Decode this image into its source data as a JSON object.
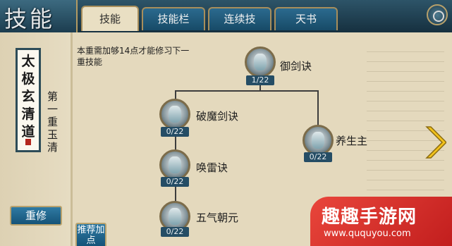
{
  "header": {
    "title": "技能",
    "tabs": [
      {
        "label": "技能",
        "active": true
      },
      {
        "label": "技能栏",
        "active": false
      },
      {
        "label": "连续技",
        "active": false
      },
      {
        "label": "天书",
        "active": false
      }
    ],
    "close_icon": "close-icon"
  },
  "left_panel": {
    "scroll_text": "太极玄清道",
    "stage_label": "第一重玉清",
    "reset_button": "重修"
  },
  "main": {
    "notice": "本重需加够14点才能修习下一重技能",
    "recommend_button": "推荐加点",
    "skills": [
      {
        "name": "御剑诀",
        "level": "1/22",
        "icon": "sword-skill-icon"
      },
      {
        "name": "破魔剑诀",
        "level": "0/22",
        "icon": "sword-break-skill-icon"
      },
      {
        "name": "养生主",
        "level": "0/22",
        "icon": "nourish-skill-icon"
      },
      {
        "name": "唤雷诀",
        "level": "0/22",
        "icon": "thunder-skill-icon"
      },
      {
        "name": "五气朝元",
        "level": "0/22",
        "icon": "five-qi-skill-icon"
      }
    ],
    "next_arrow_icon": "chevron-right-icon"
  },
  "watermark": {
    "title": "趣趣手游网",
    "url": "www.ququyou.com"
  },
  "colors": {
    "tab_active": "#e9dfc3",
    "tab_inactive": "#2b6a8e",
    "panel_bg": "#e4d9bd",
    "level_badge": "#254d65",
    "watermark_red": "#d6312b"
  }
}
